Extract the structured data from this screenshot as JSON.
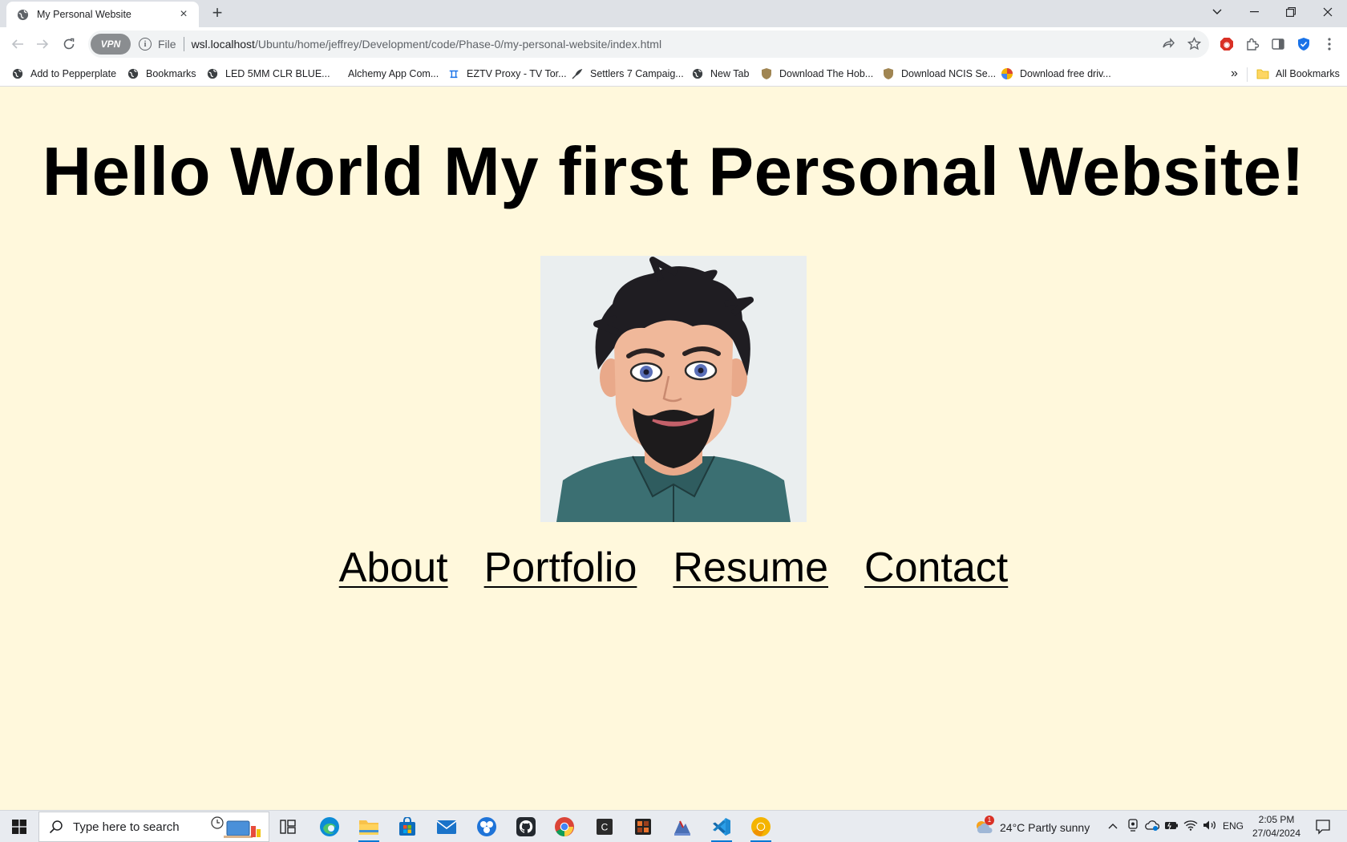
{
  "browser": {
    "tab_title": "My Personal Website",
    "tab_close": "×",
    "new_tab": "+",
    "vpn_label": "VPN",
    "scheme_label": "File",
    "url_host": "wsl.localhost",
    "url_path": "/Ubuntu/home/jeffrey/Development/code/Phase-0/my-personal-website/index.html"
  },
  "bookmarks": {
    "items": [
      {
        "label": "Add to Pepperplate",
        "icon": "globe-icon"
      },
      {
        "label": "Bookmarks",
        "icon": "globe-icon"
      },
      {
        "label": "LED 5MM CLR BLUE...",
        "icon": "globe-icon"
      },
      {
        "label": "Alchemy App Com...",
        "icon": "none"
      },
      {
        "label": "EZTV Proxy - TV Tor...",
        "icon": "eztv-icon"
      },
      {
        "label": "Settlers 7 Campaig...",
        "icon": "feather-icon"
      },
      {
        "label": "New Tab",
        "icon": "globe-icon"
      },
      {
        "label": "Download The Hob...",
        "icon": "shield-icon"
      },
      {
        "label": "Download NCIS Se...",
        "icon": "shield-icon"
      },
      {
        "label": "Download free driv...",
        "icon": "swirl-icon"
      }
    ],
    "overflow": "»",
    "all_bookmarks": "All Bookmarks"
  },
  "page": {
    "heading": "Hello World My first Personal Website!",
    "nav": {
      "about": "About",
      "portfolio": "Portfolio",
      "resume": "Resume",
      "contact": "Contact"
    }
  },
  "taskbar": {
    "search_placeholder": "Type here to search",
    "weather_badge": "1",
    "weather_text": "24°C  Partly sunny",
    "language": "ENG",
    "time": "2:05 PM",
    "date": "27/04/2024"
  },
  "colors": {
    "page_background": "#fff8dc",
    "shirt": "#3b6f72",
    "accent": "#0078d4"
  }
}
